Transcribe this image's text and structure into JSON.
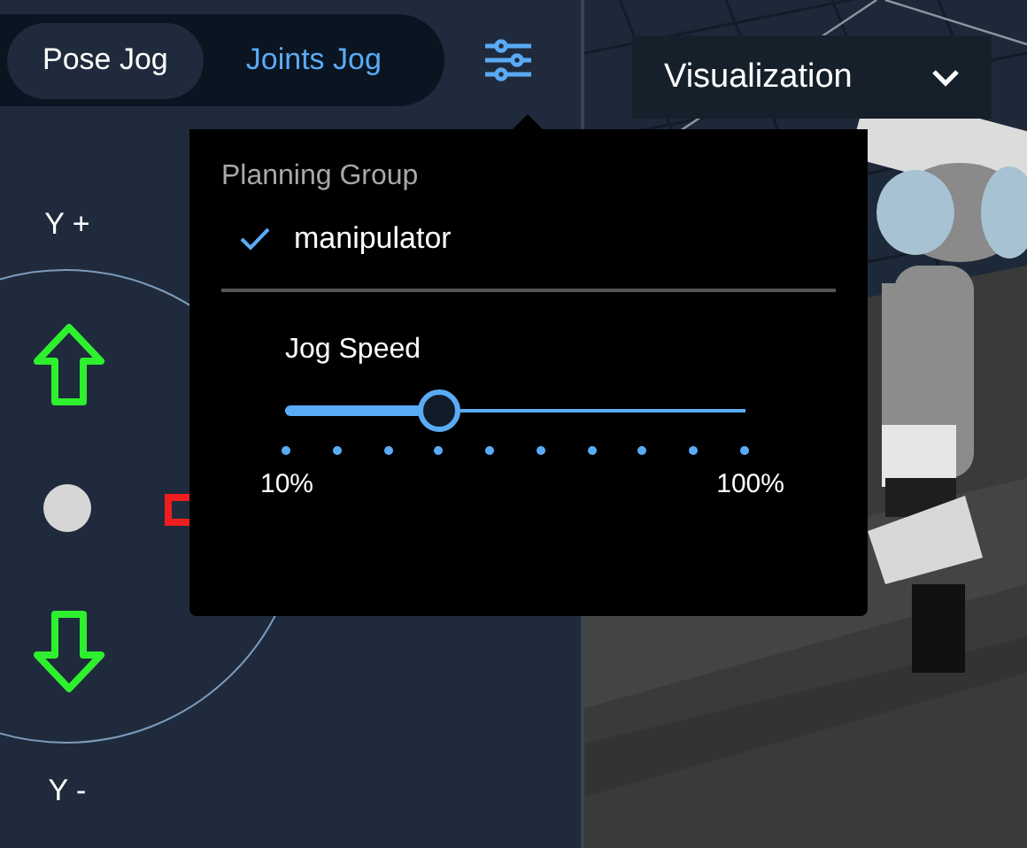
{
  "mode_tabs": [
    {
      "label": "Pose Jog",
      "selected": true
    },
    {
      "label": "Joints Jog",
      "selected": false
    }
  ],
  "view_select": {
    "value": "Visualization"
  },
  "joystick": {
    "top_label": "Y +",
    "bottom_label": "Y -"
  },
  "planning_menu": {
    "title": "Planning Group",
    "groups": [
      {
        "label": "manipulator",
        "checked": true
      }
    ],
    "jog_speed": {
      "label": "Jog Speed",
      "level": 0.333,
      "min_label": "10%",
      "max_label": "100%"
    }
  }
}
